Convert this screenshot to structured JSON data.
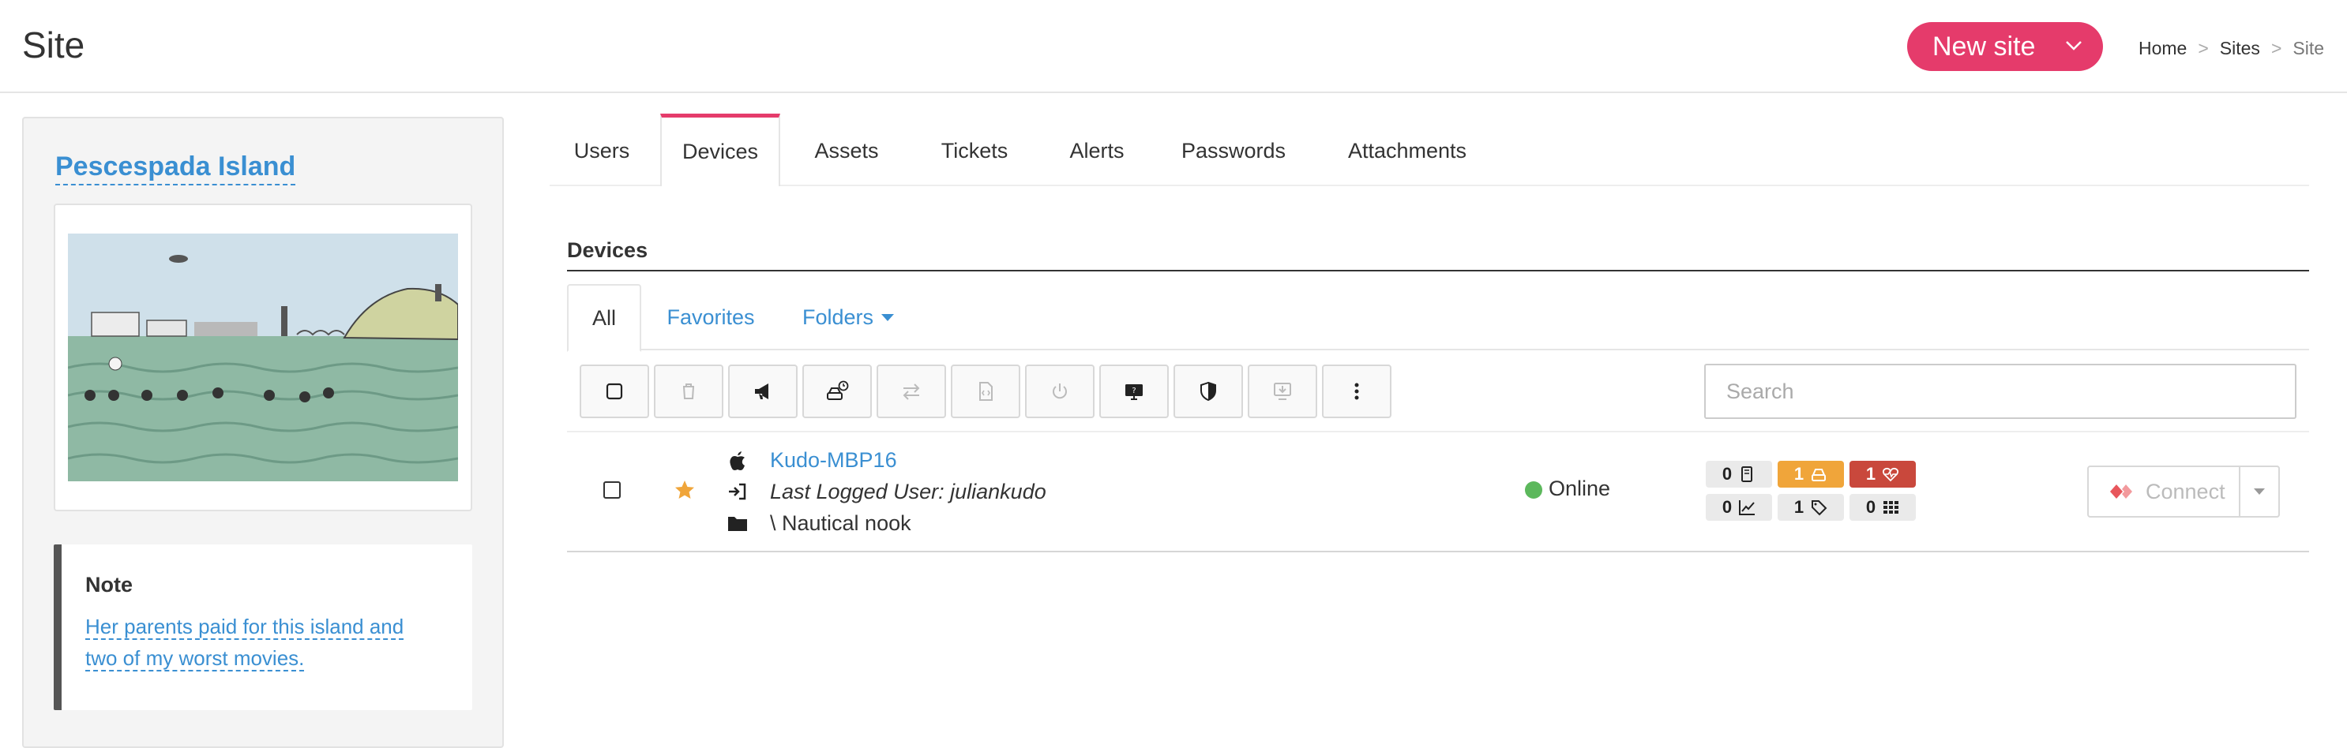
{
  "header": {
    "title": "Site",
    "new_site_label": "New site",
    "breadcrumb": [
      {
        "label": "Home"
      },
      {
        "label": "Sites"
      },
      {
        "label": "Site"
      }
    ],
    "breadcrumb_sep": ">"
  },
  "site": {
    "name": "Pescespada Island",
    "note_title": "Note",
    "note_lines": [
      "Her parents paid for this island and",
      "two of my worst movies."
    ]
  },
  "tabs": [
    {
      "label": "Users",
      "active": false
    },
    {
      "label": "Devices",
      "active": true
    },
    {
      "label": "Assets",
      "active": false
    },
    {
      "label": "Tickets",
      "active": false
    },
    {
      "label": "Alerts",
      "active": false
    },
    {
      "label": "Passwords",
      "active": false
    },
    {
      "label": "Attachments",
      "active": false
    }
  ],
  "devices": {
    "section_title": "Devices",
    "subtabs": [
      {
        "label": "All",
        "active": true
      },
      {
        "label": "Favorites",
        "active": false
      },
      {
        "label": "Folders",
        "active": false
      }
    ],
    "search_placeholder": "Search",
    "toolbar_icons": [
      "checkbox-icon",
      "trash-icon",
      "megaphone-icon",
      "drive-clock-icon",
      "transfer-icon",
      "script-icon",
      "power-icon",
      "remote-screen-icon",
      "shield-icon",
      "install-icon",
      "more-vertical-icon"
    ],
    "rows": [
      {
        "os_icon": "apple-icon",
        "name": "Kudo-MBP16",
        "last_user": "Last Logged User: juliankudo",
        "folder": "\\ Nautical nook",
        "favorite": true,
        "status": "Online",
        "badges": [
          {
            "count": "0",
            "icon": "device-icon",
            "style": "grey"
          },
          {
            "count": "1",
            "icon": "drive-icon",
            "style": "orange"
          },
          {
            "count": "1",
            "icon": "health-icon",
            "style": "red"
          },
          {
            "count": "0",
            "icon": "chart-icon",
            "style": "grey"
          },
          {
            "count": "1",
            "icon": "tag-icon",
            "style": "grey"
          },
          {
            "count": "0",
            "icon": "apps-icon",
            "style": "grey"
          }
        ],
        "connect_label": "Connect"
      }
    ]
  },
  "colors": {
    "accent": "#e53b6b",
    "link": "#3a8fd2",
    "online": "#5cb85c",
    "badge_orange": "#f0a53a",
    "badge_red": "#c9483c"
  }
}
